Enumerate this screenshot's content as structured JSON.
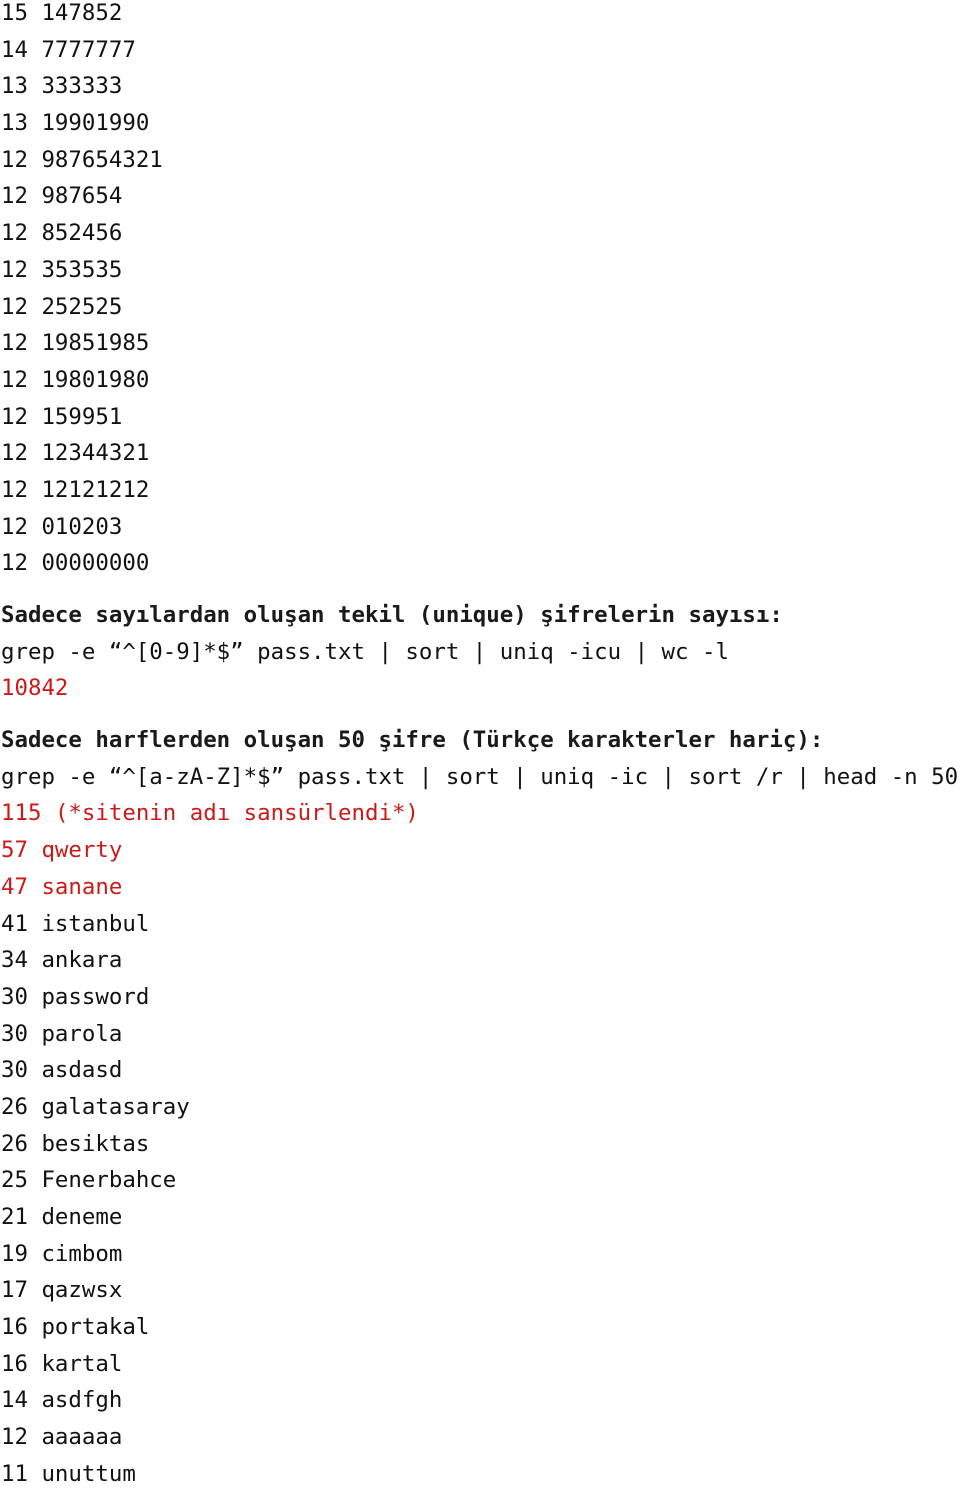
{
  "top_list": [
    {
      "count": "15",
      "value": "147852"
    },
    {
      "count": "14",
      "value": "7777777"
    },
    {
      "count": "13",
      "value": "333333"
    },
    {
      "count": "13",
      "value": "19901990"
    },
    {
      "count": "12",
      "value": "987654321"
    },
    {
      "count": "12",
      "value": "987654"
    },
    {
      "count": "12",
      "value": "852456"
    },
    {
      "count": "12",
      "value": "353535"
    },
    {
      "count": "12",
      "value": "252525"
    },
    {
      "count": "12",
      "value": "19851985"
    },
    {
      "count": "12",
      "value": "19801980"
    },
    {
      "count": "12",
      "value": "159951"
    },
    {
      "count": "12",
      "value": "12344321"
    },
    {
      "count": "12",
      "value": "12121212"
    },
    {
      "count": "12",
      "value": "010203"
    },
    {
      "count": "12",
      "value": "00000000"
    }
  ],
  "section_numeric": {
    "heading": "Sadece sayılardan oluşan tekil (unique) şifrelerin sayısı:",
    "command": "grep -e “^[0-9]*$” pass.txt | sort | uniq -icu | wc -l",
    "result": "10842"
  },
  "section_alpha": {
    "heading": "Sadece harflerden oluşan 50 şifre (Türkçe karakterler hariç):",
    "command": "grep -e “^[a-zA-Z]*$” pass.txt | sort | uniq -ic | sort /r | head -n 50",
    "results": [
      {
        "count": "115",
        "value": "(*sitenin adı sansürlendi*)",
        "highlighted": true
      },
      {
        "count": "57",
        "value": "qwerty",
        "highlighted": true
      },
      {
        "count": "47",
        "value": "sanane",
        "highlighted": true
      },
      {
        "count": "41",
        "value": "istanbul",
        "highlighted": false
      },
      {
        "count": "34",
        "value": "ankara",
        "highlighted": false
      },
      {
        "count": "30",
        "value": "password",
        "highlighted": false
      },
      {
        "count": "30",
        "value": "parola",
        "highlighted": false
      },
      {
        "count": "30",
        "value": "asdasd",
        "highlighted": false
      },
      {
        "count": "26",
        "value": "galatasaray",
        "highlighted": false
      },
      {
        "count": "26",
        "value": "besiktas",
        "highlighted": false
      },
      {
        "count": "25",
        "value": "Fenerbahce",
        "highlighted": false
      },
      {
        "count": "21",
        "value": "deneme",
        "highlighted": false
      },
      {
        "count": "19",
        "value": "cimbom",
        "highlighted": false
      },
      {
        "count": "17",
        "value": "qazwsx",
        "highlighted": false
      },
      {
        "count": "16",
        "value": "portakal",
        "highlighted": false
      },
      {
        "count": "16",
        "value": "kartal",
        "highlighted": false
      },
      {
        "count": "14",
        "value": "asdfgh",
        "highlighted": false
      },
      {
        "count": "12",
        "value": "aaaaaa",
        "highlighted": false
      },
      {
        "count": "11",
        "value": "unuttum",
        "highlighted": false
      }
    ]
  },
  "colors": {
    "text": "#111111",
    "highlight": "#cc1a1a",
    "background": "#ffffff"
  }
}
